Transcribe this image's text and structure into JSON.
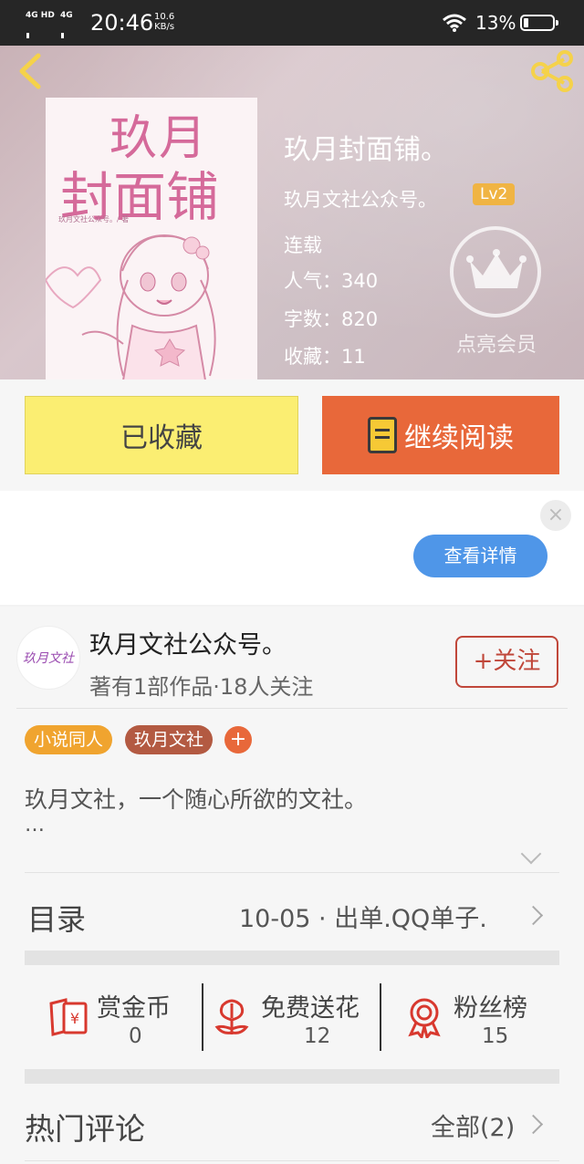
{
  "status_bar": {
    "network_1": "4G HD",
    "network_2": "4G",
    "time": "20:46",
    "speed_value": "10.6",
    "speed_unit": "KB/s",
    "battery": "13%"
  },
  "header": {
    "back_icon": "chevron-left-icon",
    "share_icon": "share-icon",
    "cover_text_line1": "玖月",
    "cover_text_line2": "封面铺",
    "cover_small_text": "玖月文社公众号。/ 著",
    "book_title": "玖月封面铺。",
    "author": "玖月文社公众号。",
    "level": "Lv2",
    "status": "连载",
    "popularity": "人气：340",
    "word_count": "字数：820",
    "favorites": "收藏：11",
    "member_icon": "crown-icon",
    "member_label": "点亮会员"
  },
  "actions": {
    "favorited_label": "已收藏",
    "continue_label": "继续阅读",
    "continue_icon": "book-icon"
  },
  "ad": {
    "details_label": "查看详情",
    "close_icon": "close-icon"
  },
  "author_card": {
    "avatar_text": "玖月文社",
    "name": "玖月文社公众号。",
    "meta": "著有1部作品·18人关注",
    "follow_label": "+关注"
  },
  "tags": [
    "小说同人",
    "玖月文社"
  ],
  "add_tag_label": "+",
  "description": "玖月文社，一个随心所欲的文社。",
  "description_more": "…",
  "toc": {
    "label": "目录",
    "latest": "10-05 · 出单.QQ单子."
  },
  "stats": [
    {
      "label": "赏金币",
      "value": "0",
      "icon": "red-envelope-icon"
    },
    {
      "label": "免费送花",
      "value": "12",
      "icon": "flower-icon"
    },
    {
      "label": "粉丝榜",
      "value": "15",
      "icon": "medal-icon"
    }
  ],
  "comments": {
    "label": "热门评论",
    "all_label": "全部(2)"
  },
  "colors": {
    "accent_orange": "#e8683a",
    "favorite_yellow": "#fbee72",
    "follow_red": "#c0473a",
    "ad_blue": "#4f96e8",
    "level_badge": "#f0b443",
    "icon_red": "#d8392f"
  }
}
